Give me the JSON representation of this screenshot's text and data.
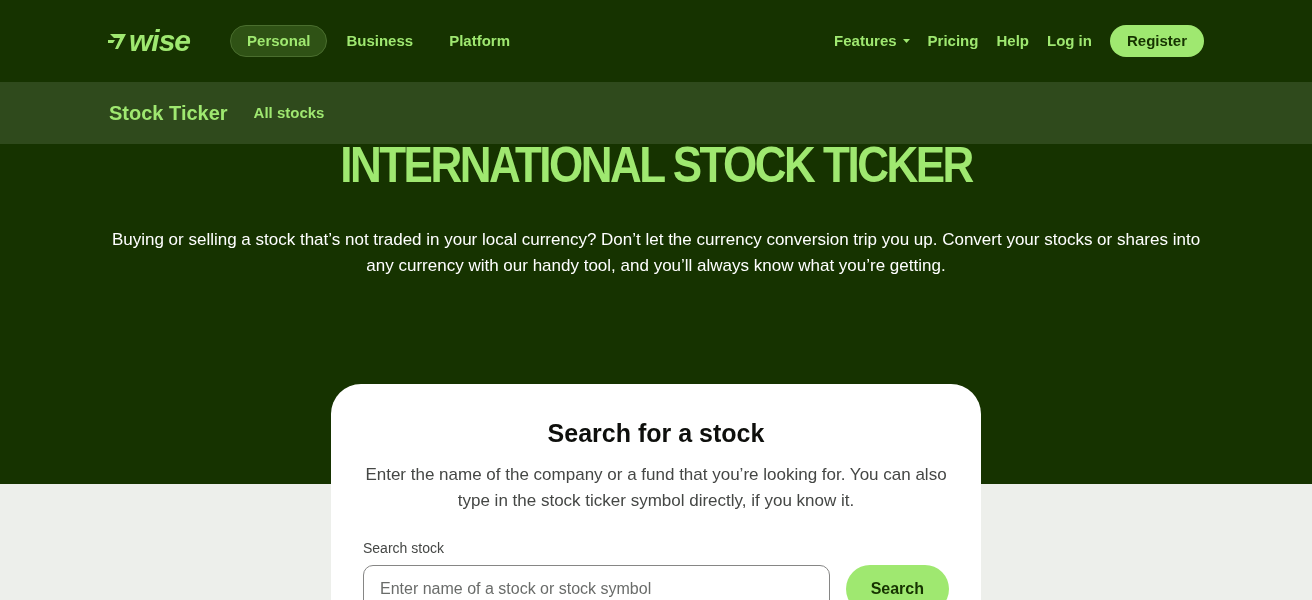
{
  "header": {
    "logo": "wise",
    "nav_left": [
      {
        "label": "Personal",
        "selected": true
      },
      {
        "label": "Business",
        "selected": false
      },
      {
        "label": "Platform",
        "selected": false
      }
    ],
    "nav_right": [
      {
        "label": "Features",
        "kind": "dropdown"
      },
      {
        "label": "Pricing",
        "kind": "link"
      },
      {
        "label": "Help",
        "kind": "link"
      },
      {
        "label": "Log in",
        "kind": "link"
      },
      {
        "label": "Register",
        "kind": "button"
      }
    ]
  },
  "subnav": {
    "title": "Stock Ticker",
    "links": [
      "All stocks"
    ]
  },
  "hero": {
    "title": "INTERNATIONAL STOCK TICKER",
    "text": "Buying or selling a stock that’s not traded in your local currency? Don’t let the currency conversion trip you up. Convert your stocks or shares into any currency with our handy tool, and you’ll always know what you’re getting."
  },
  "search_card": {
    "title": "Search for a stock",
    "text": "Enter the name of the company or a fund that you’re looking for. You can also type in the stock ticker symbol directly, if you know it.",
    "field_label": "Search stock",
    "placeholder": "Enter name of a stock or stock symbol",
    "button": "Search"
  }
}
